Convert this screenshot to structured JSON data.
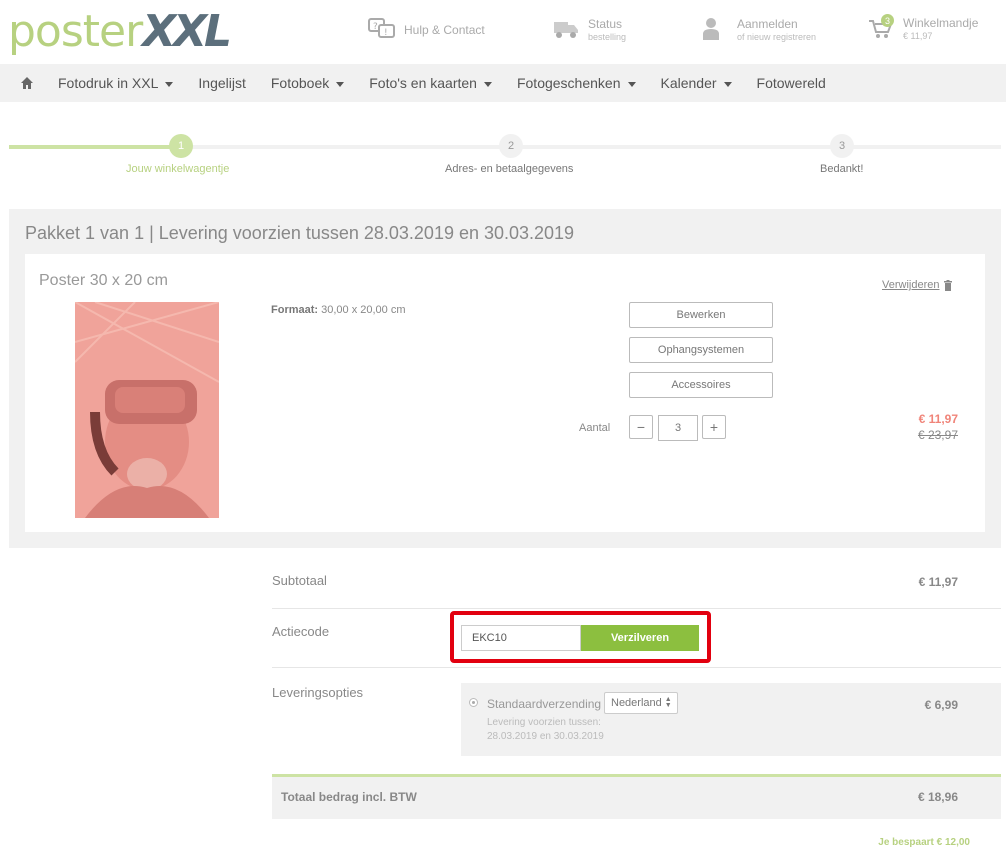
{
  "header": {
    "logo_part1": "poster",
    "logo_part2": "XXL",
    "help_label": "Hulp & Contact",
    "status_label": "Status",
    "status_sub": "bestelling",
    "login_label": "Aanmelden",
    "login_sub": "of nieuw registreren",
    "cart_label": "Winkelmandje",
    "cart_sub": "€ 11,97",
    "cart_count": "3"
  },
  "nav": {
    "home_icon": "home-icon",
    "items": [
      {
        "label": "Fotodruk in XXL",
        "dropdown": true
      },
      {
        "label": "Ingelijst",
        "dropdown": false
      },
      {
        "label": "Fotoboek",
        "dropdown": true
      },
      {
        "label": "Foto's en kaarten",
        "dropdown": true
      },
      {
        "label": "Fotogeschenken",
        "dropdown": true
      },
      {
        "label": "Kalender",
        "dropdown": true
      },
      {
        "label": "Fotowereld",
        "dropdown": false
      }
    ]
  },
  "progress": {
    "steps": [
      {
        "num": "1",
        "label": "Jouw winkelwagentje",
        "active": true
      },
      {
        "num": "2",
        "label": "Adres- en betaalgegevens",
        "active": false
      },
      {
        "num": "3",
        "label": "Bedankt!",
        "active": false
      }
    ]
  },
  "package": {
    "title": "Pakket 1 van 1 | Levering voorzien tussen 28.03.2019 en 30.03.2019",
    "product_title": "Poster 30 x 20 cm",
    "remove_label": "Verwijderen",
    "format_label": "Formaat:",
    "format_value": "30,00 x 20,00 cm",
    "buttons": {
      "edit": "Bewerken",
      "hanging": "Ophangsystemen",
      "accessories": "Accessoires"
    },
    "qty_label": "Aantal",
    "qty_minus": "−",
    "qty_value": "3",
    "qty_plus": "+",
    "price_new": "€ 11,97",
    "price_old": "€ 23,97"
  },
  "summary": {
    "subtotal_label": "Subtotaal",
    "subtotal_value": "€ 11,97",
    "promo_label": "Actiecode",
    "promo_value": "EKC10",
    "promo_button": "Verzilveren",
    "shipping_label": "Leveringsopties",
    "shipping_name": "Standaardverzending",
    "shipping_country": "Nederland",
    "shipping_note_1": "Levering voorzien tussen:",
    "shipping_note_2": "28.03.2019 en 30.03.2019",
    "shipping_price": "€ 6,99",
    "total_label": "Totaal bedrag incl. BTW",
    "total_value": "€ 18,96",
    "savings": "Je bespaart € 12,00"
  },
  "colors": {
    "accent_green": "#b7d180",
    "button_green": "#8cbf3f",
    "highlight_red": "#e2000f",
    "price_red": "#f08479"
  }
}
